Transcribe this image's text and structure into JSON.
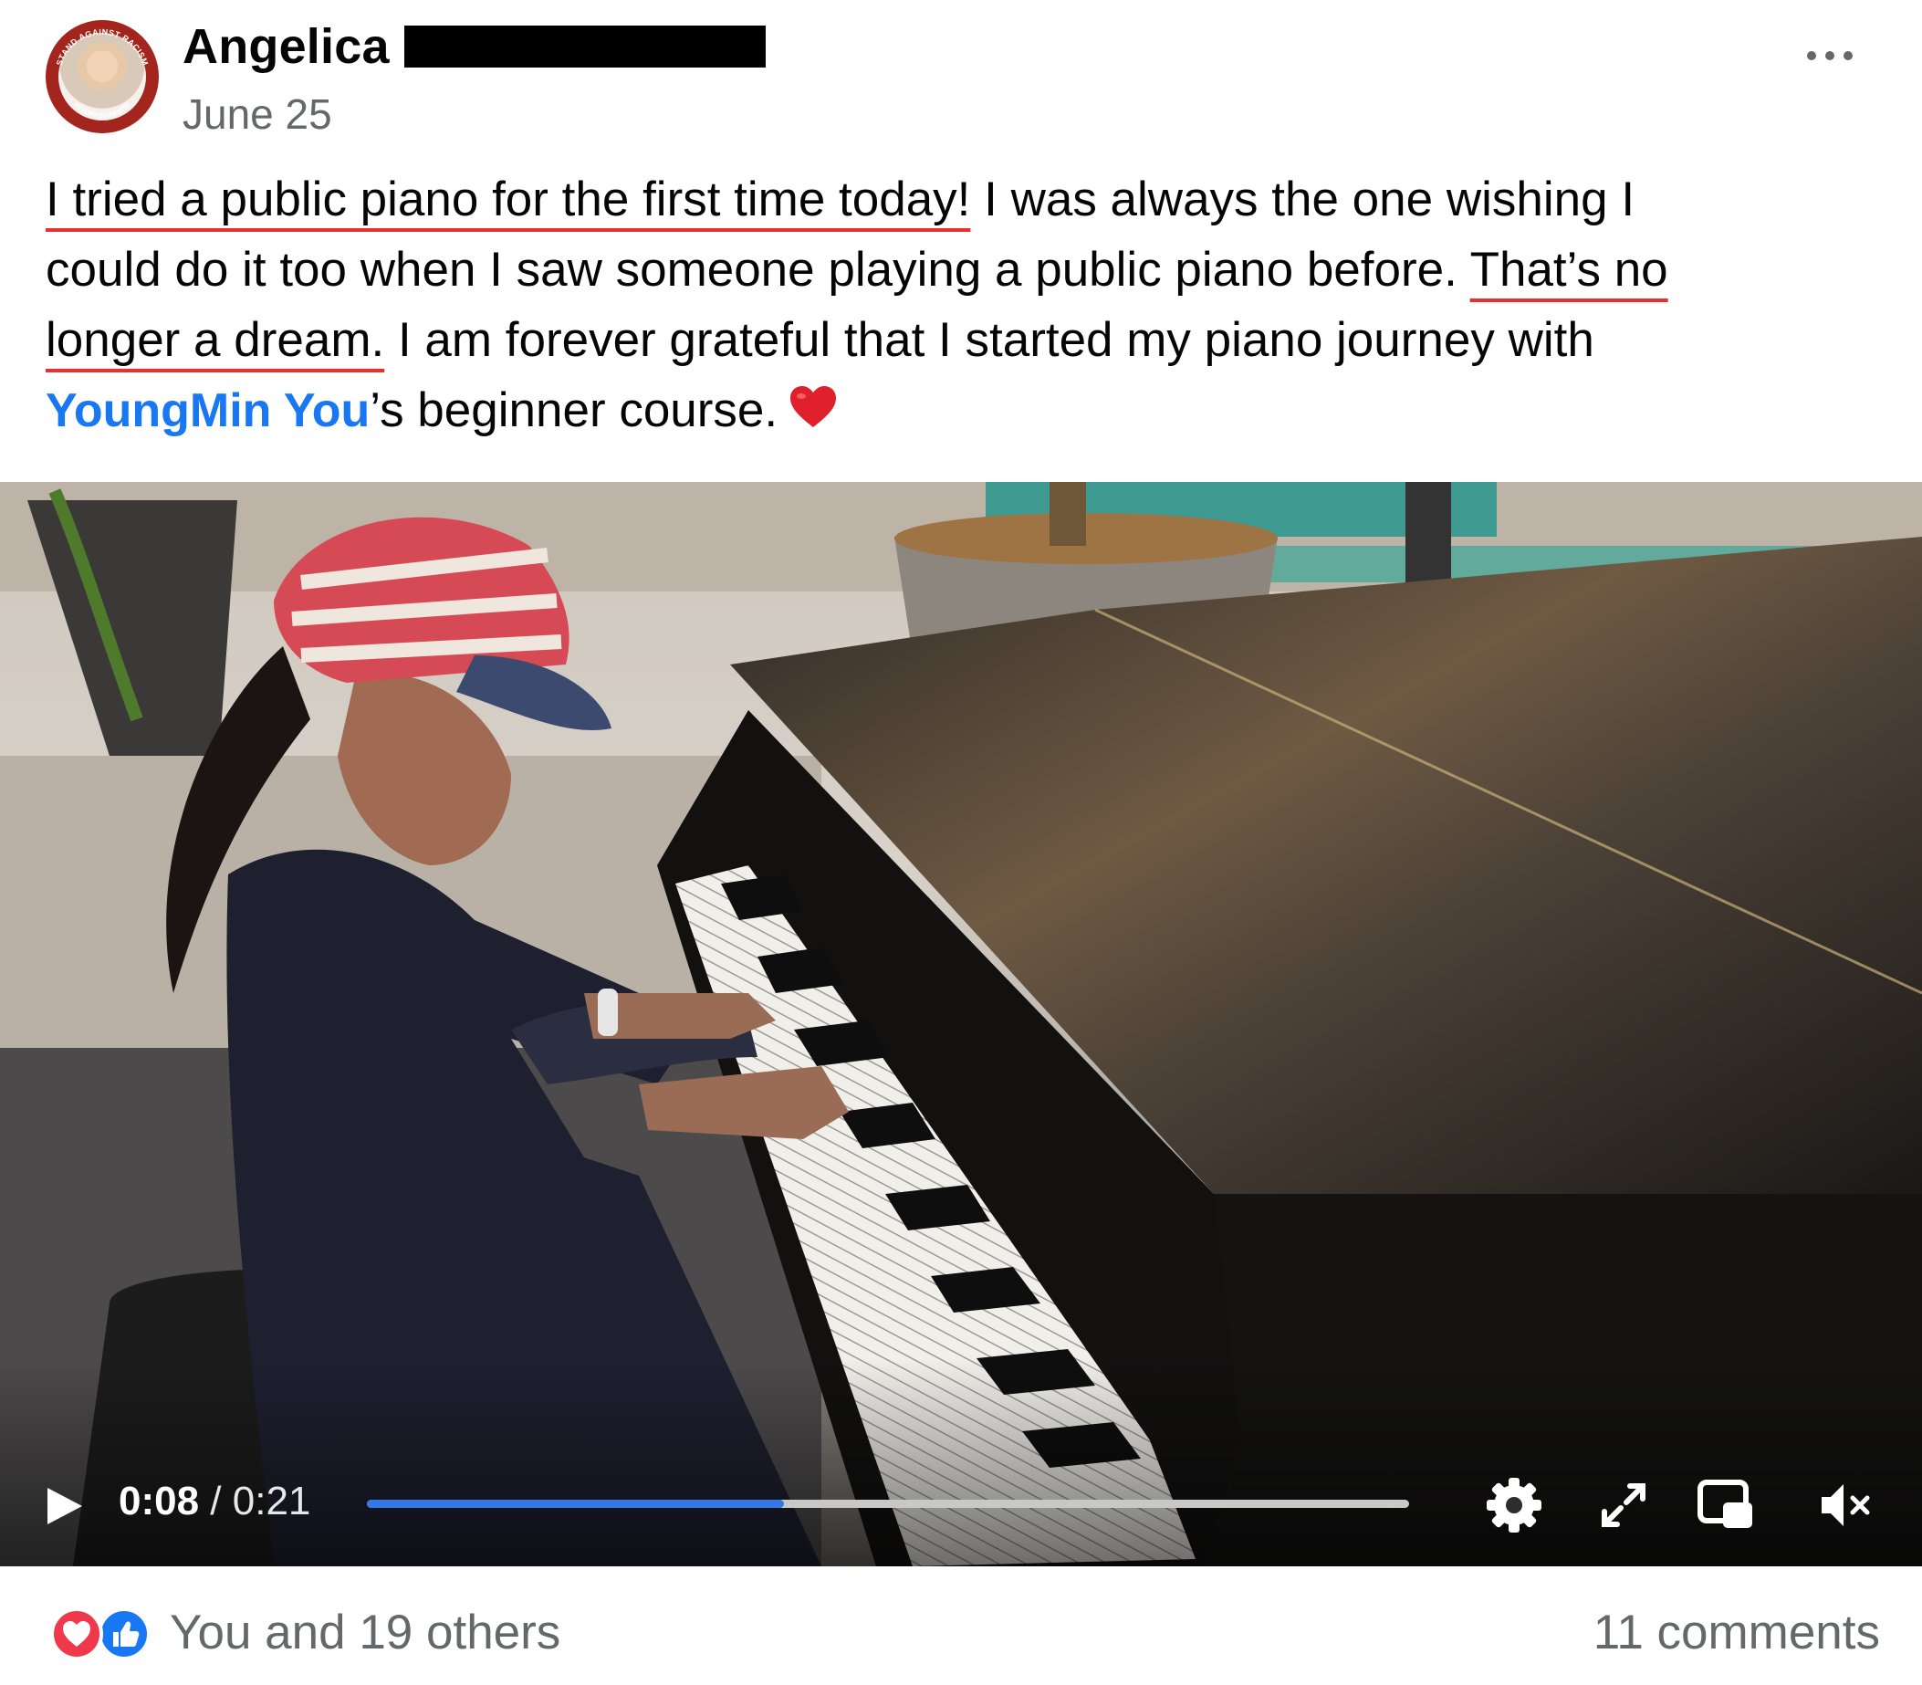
{
  "post": {
    "author_name": "Angelica",
    "avatar_ring_top": "STAND AGAINST RACISM",
    "avatar_ring_bottom": "#STOPASIANHATE",
    "date": "June 25",
    "more_icon": "more-horizontal-icon",
    "text": {
      "line1_underlined": "I tried a public piano for the first time today!",
      "line1_rest": " I was always the one wishing I",
      "line2_plain": "could do it too when I saw someone playing a public piano before. ",
      "line2_underlined": "That’s no",
      "line3_underlined": "longer a dream.",
      "line3_rest": " I am forever grateful that I started my piano journey with",
      "mention": "YoungMin You",
      "line4_rest": "’s beginner course.",
      "emoji": "red-heart-emoji"
    },
    "underline_color": "#e6312e"
  },
  "video": {
    "current_time": "0:08",
    "separator": " / ",
    "duration": "0:21",
    "progress": 0.4,
    "progress_color": "#3578e5",
    "icons": [
      "play-icon",
      "settings-gear-icon",
      "fullscreen-icon",
      "picture-in-picture-icon",
      "muted-speaker-icon"
    ]
  },
  "footer": {
    "reaction_icons": [
      "love-reaction-icon",
      "like-reaction-icon"
    ],
    "reactions_text": "You and 19 others",
    "comments_text": "11 comments"
  },
  "colors": {
    "link_blue": "#1877f2",
    "secondary_text": "#65676b"
  }
}
